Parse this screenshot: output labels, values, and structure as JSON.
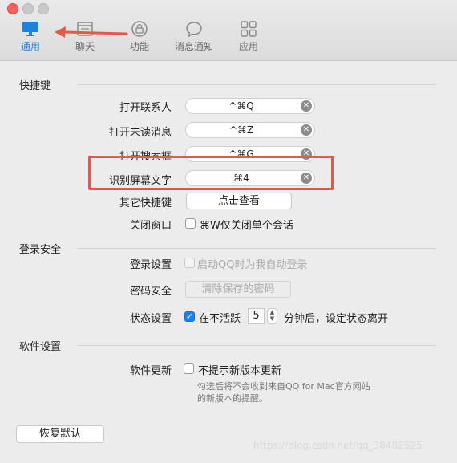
{
  "tabs": [
    {
      "label": "通用",
      "icon": "monitor-icon"
    },
    {
      "label": "聊天",
      "icon": "chat-window-icon"
    },
    {
      "label": "功能",
      "icon": "lock-circle-icon"
    },
    {
      "label": "消息通知",
      "icon": "speech-bubble-icon"
    },
    {
      "label": "应用",
      "icon": "grid-icon"
    }
  ],
  "shortcuts": {
    "title": "快捷键",
    "items": [
      {
        "label": "打开联系人",
        "keys": "^⌘Q"
      },
      {
        "label": "打开未读消息",
        "keys": "^⌘Z"
      },
      {
        "label": "打开搜索框",
        "keys": "^⌘G"
      },
      {
        "label": "识别屏幕文字",
        "keys": "⌘4"
      }
    ],
    "other_label": "其它快捷键",
    "other_button": "点击查看",
    "close_window_label": "关闭窗口",
    "close_window_option": "⌘W仅关闭单个会话"
  },
  "login_security": {
    "title": "登录安全",
    "login_label": "登录设置",
    "login_option": "启动QQ时为我自动登录",
    "password_label": "密码安全",
    "password_button": "清除保存的密码",
    "status_label": "状态设置",
    "status_prefix": "在不活跃",
    "status_minutes": "5",
    "status_suffix": "分钟后，设定状态离开"
  },
  "software": {
    "title": "软件设置",
    "update_label": "软件更新",
    "update_option": "不提示新版本更新",
    "hint_line1": "勾选后将不会收到来自QQ for Mac官方网站",
    "hint_line2": "的新版本的提醒。"
  },
  "restore_button": "恢复默认",
  "watermark": "https://blog.csdn.net/qq_38482525",
  "colors": {
    "accent": "#1a82e2",
    "annotation": "#e6594a"
  }
}
